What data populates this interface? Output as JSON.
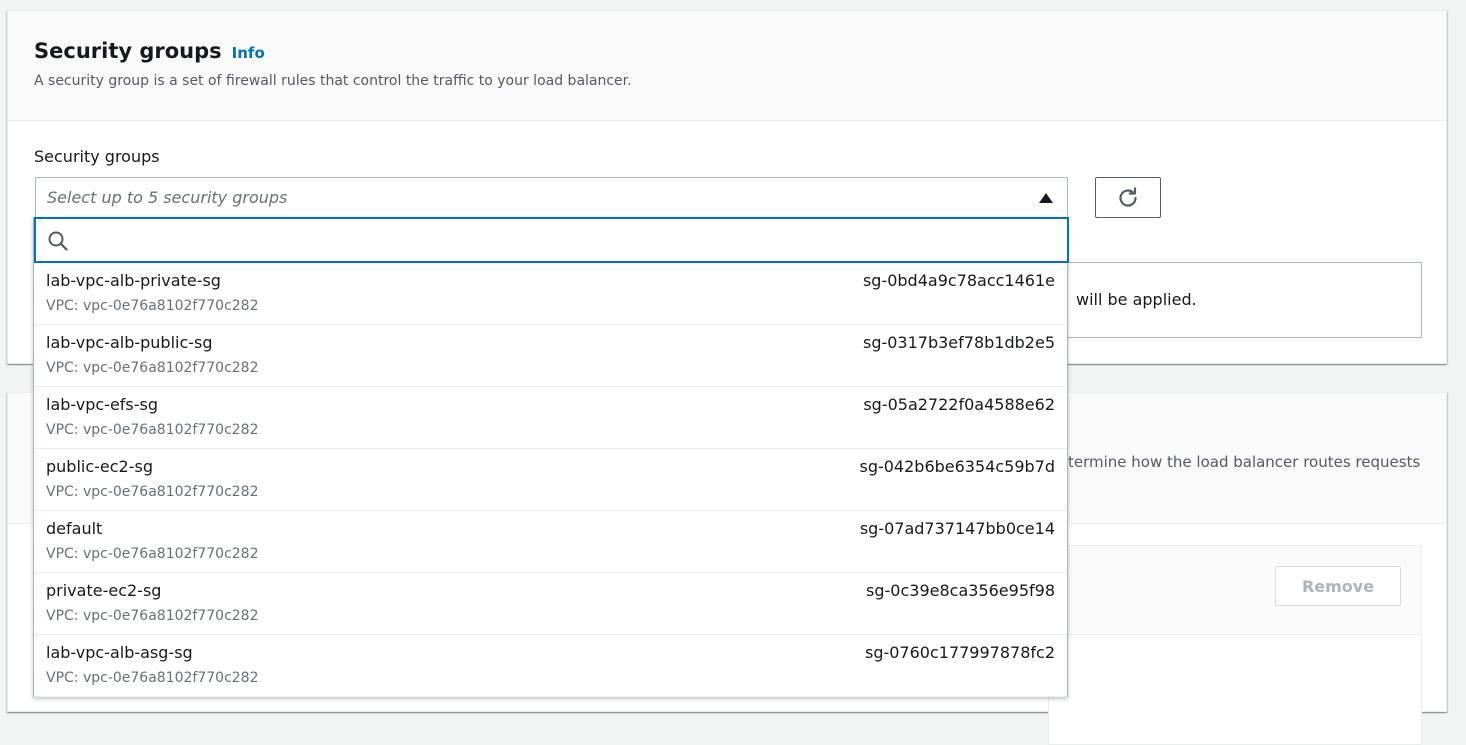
{
  "security_groups_panel": {
    "title": "Security groups",
    "info_link": "Info",
    "description": "A security group is a set of firewall rules that control the traffic to your load balancer.",
    "field_label": "Security groups",
    "select_placeholder": "Select up to 5 security groups",
    "search_placeholder": "",
    "refresh_icon": "refresh-icon",
    "alert_visible_text": "will be applied."
  },
  "listeners_panel": {
    "description_fragment": "termine how the load balancer routes requests",
    "remove_button": "Remove"
  },
  "dropdown_options": [
    {
      "name": "lab-vpc-alb-private-sg",
      "vpc": "VPC: vpc-0e76a8102f770c282",
      "id": "sg-0bd4a9c78acc1461e"
    },
    {
      "name": "lab-vpc-alb-public-sg",
      "vpc": "VPC: vpc-0e76a8102f770c282",
      "id": "sg-0317b3ef78b1db2e5"
    },
    {
      "name": "lab-vpc-efs-sg",
      "vpc": "VPC: vpc-0e76a8102f770c282",
      "id": "sg-05a2722f0a4588e62"
    },
    {
      "name": "public-ec2-sg",
      "vpc": "VPC: vpc-0e76a8102f770c282",
      "id": "sg-042b6be6354c59b7d"
    },
    {
      "name": "default",
      "vpc": "VPC: vpc-0e76a8102f770c282",
      "id": "sg-07ad737147bb0ce14"
    },
    {
      "name": "private-ec2-sg",
      "vpc": "VPC: vpc-0e76a8102f770c282",
      "id": "sg-0c39e8ca356e95f98"
    },
    {
      "name": "lab-vpc-alb-asg-sg",
      "vpc": "VPC: vpc-0e76a8102f770c282",
      "id": "sg-0760c177997878fc2"
    }
  ],
  "colors": {
    "accent": "#0073bb",
    "text": "#16191f",
    "secondary_text": "#687078",
    "disabled": "#aab7b8"
  }
}
